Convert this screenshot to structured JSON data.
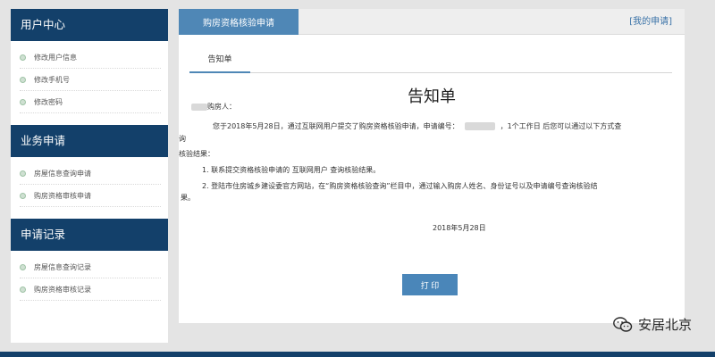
{
  "sidebar": {
    "sections": [
      {
        "title": "用户中心",
        "items": [
          "修改用户信息",
          "修改手机号",
          "修改密码"
        ]
      },
      {
        "title": "业务申请",
        "items": [
          "房屋信息查询申请",
          "购房资格审核申请"
        ]
      },
      {
        "title": "申请记录",
        "items": [
          "房屋信息查询记录",
          "购房资格审核记录"
        ]
      }
    ]
  },
  "header": {
    "active_tab": "购房资格核验申请",
    "my_apply_link": "[我的申请]"
  },
  "subtab": "告知单",
  "notice": {
    "title": "告知单",
    "salutation": "购房人：",
    "line1_a": "您于2018年5月28日，通过互联网用户提交了购房资格核验申请，申请编号：",
    "line1_b": "，1个工作日 后您可以通过以下方式查",
    "line2": "询",
    "line3": "核验结果：",
    "item1": "1. 联系提交资格核验申请的 互联网用户 查询核验结果。",
    "item2_a": "2. 登陆市住房城乡建设委官方网站，在“购房资格核验查询”栏目中，通过输入购房人姓名、身份证号以及申请编号查询核验结",
    "item2_b": "果。",
    "date": "2018年5月28日"
  },
  "print_button": "打 印",
  "watermark": "安居北京",
  "colors": {
    "sidebar_header": "#13406a",
    "tab_active": "#4f87b6",
    "button": "#4a86b9",
    "link": "#3b73a8"
  }
}
